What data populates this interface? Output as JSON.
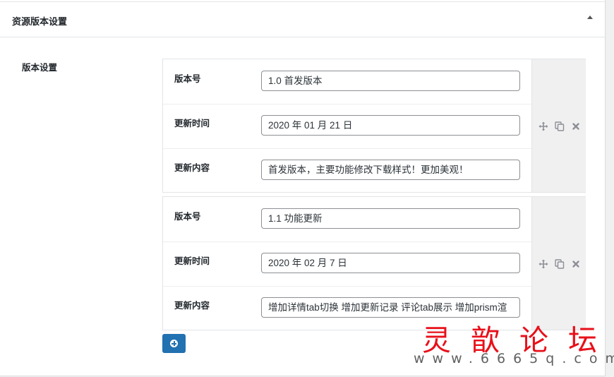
{
  "section": {
    "title": "资源版本设置"
  },
  "field": {
    "label": "版本设置"
  },
  "groups": [
    {
      "rows": [
        {
          "label": "版本号",
          "value": "1.0 首发版本"
        },
        {
          "label": "更新时间",
          "value": "2020 年 01 月 21 日"
        },
        {
          "label": "更新内容",
          "value": "首发版本，主要功能修改下载样式！更加美观！"
        }
      ]
    },
    {
      "rows": [
        {
          "label": "版本号",
          "value": "1.1 功能更新"
        },
        {
          "label": "更新时间",
          "value": "2020 年 02 月 7 日"
        },
        {
          "label": "更新内容",
          "value": "增加详情tab切换 增加更新记录 评论tab展示 增加prism渲"
        }
      ]
    }
  ],
  "icons": {
    "collapse": "caret-up-icon",
    "move": "move-arrows-icon",
    "duplicate": "copy-icon",
    "remove": "close-icon",
    "add": "plus-circle-icon"
  },
  "colors": {
    "accent": "#2271b1",
    "watermark": "#e8101a"
  },
  "watermark": {
    "chinese": "灵歆论坛",
    "url": "www.6665q.com"
  }
}
